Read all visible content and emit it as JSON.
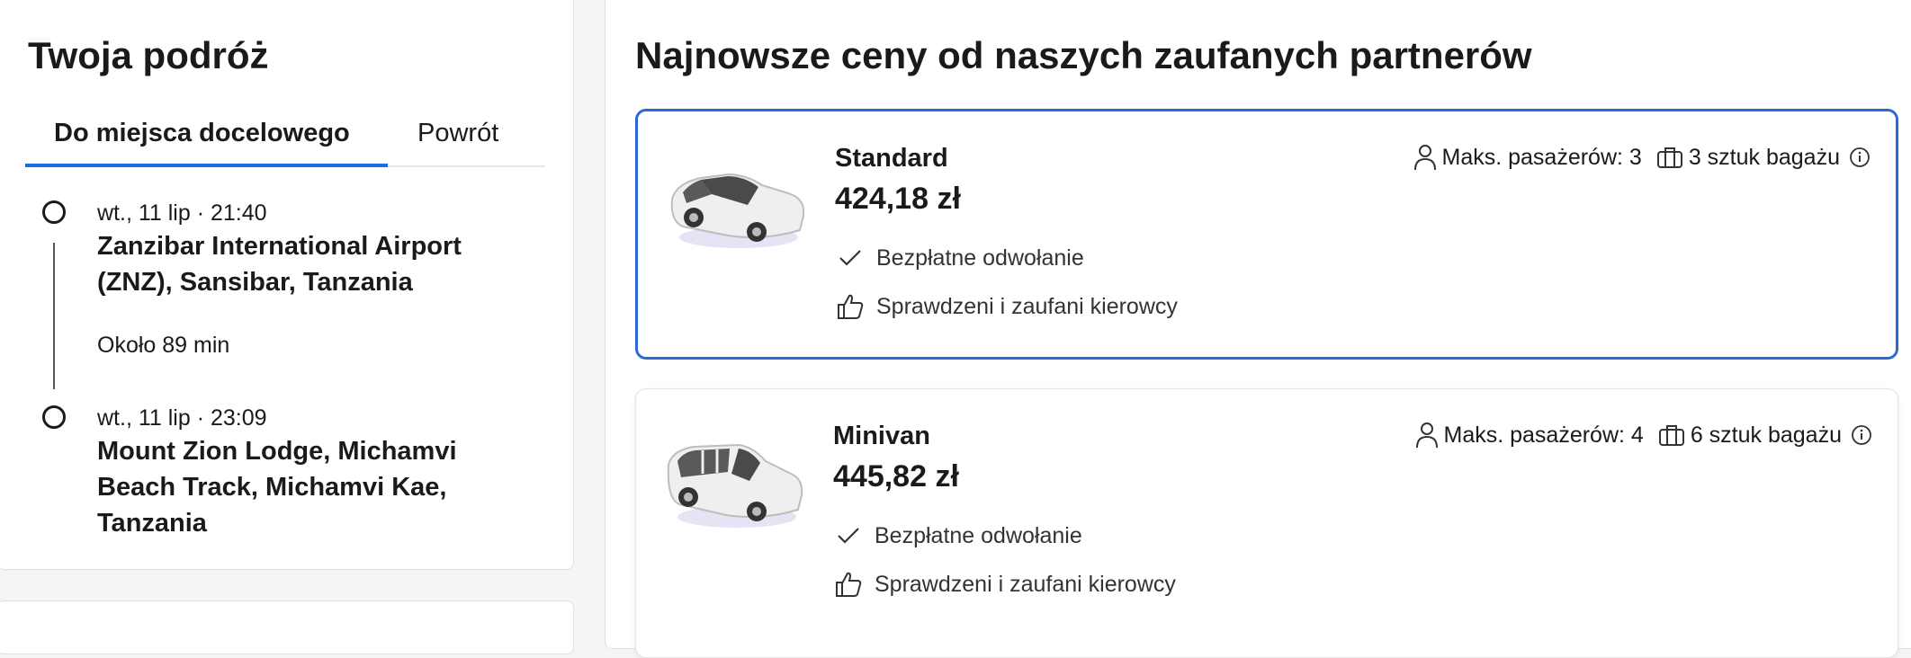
{
  "trip": {
    "title": "Twoja podróż",
    "tabs": {
      "destination": "Do miejsca docelowego",
      "return": "Powrót"
    },
    "pickup": {
      "time": "wt., 11 lip · 21:40",
      "place": "Zanzibar International Airport (ZNZ), Sansibar, Tanzania"
    },
    "duration": "Około 89 min",
    "dropoff": {
      "time": "wt., 11 lip · 23:09",
      "place": "Mount Zion Lodge, Michamvi Beach Track, Michamvi Kae, Tanzania"
    }
  },
  "offers": {
    "title": "Najnowsze ceny od naszych zaufanych partnerów",
    "items": [
      {
        "name": "Standard",
        "price": "424,18 zł",
        "passengers": "Maks. pasażerów: 3",
        "luggage": "3 sztuk bagażu",
        "feature_1": "Bezpłatne odwołanie",
        "feature_2": "Sprawdzeni i zaufani kierowcy"
      },
      {
        "name": "Minivan",
        "price": "445,82 zł",
        "passengers": "Maks. pasażerów: 4",
        "luggage": "6 sztuk bagażu",
        "feature_1": "Bezpłatne odwołanie",
        "feature_2": "Sprawdzeni i zaufani kierowcy"
      }
    ]
  },
  "colors": {
    "accent": "#1a6de0",
    "selected_border": "#2a6ad8"
  },
  "icons": [
    "person-icon",
    "luggage-icon",
    "info-icon",
    "checkmark-icon",
    "thumbs-up-icon",
    "car-icon",
    "minivan-icon"
  ]
}
